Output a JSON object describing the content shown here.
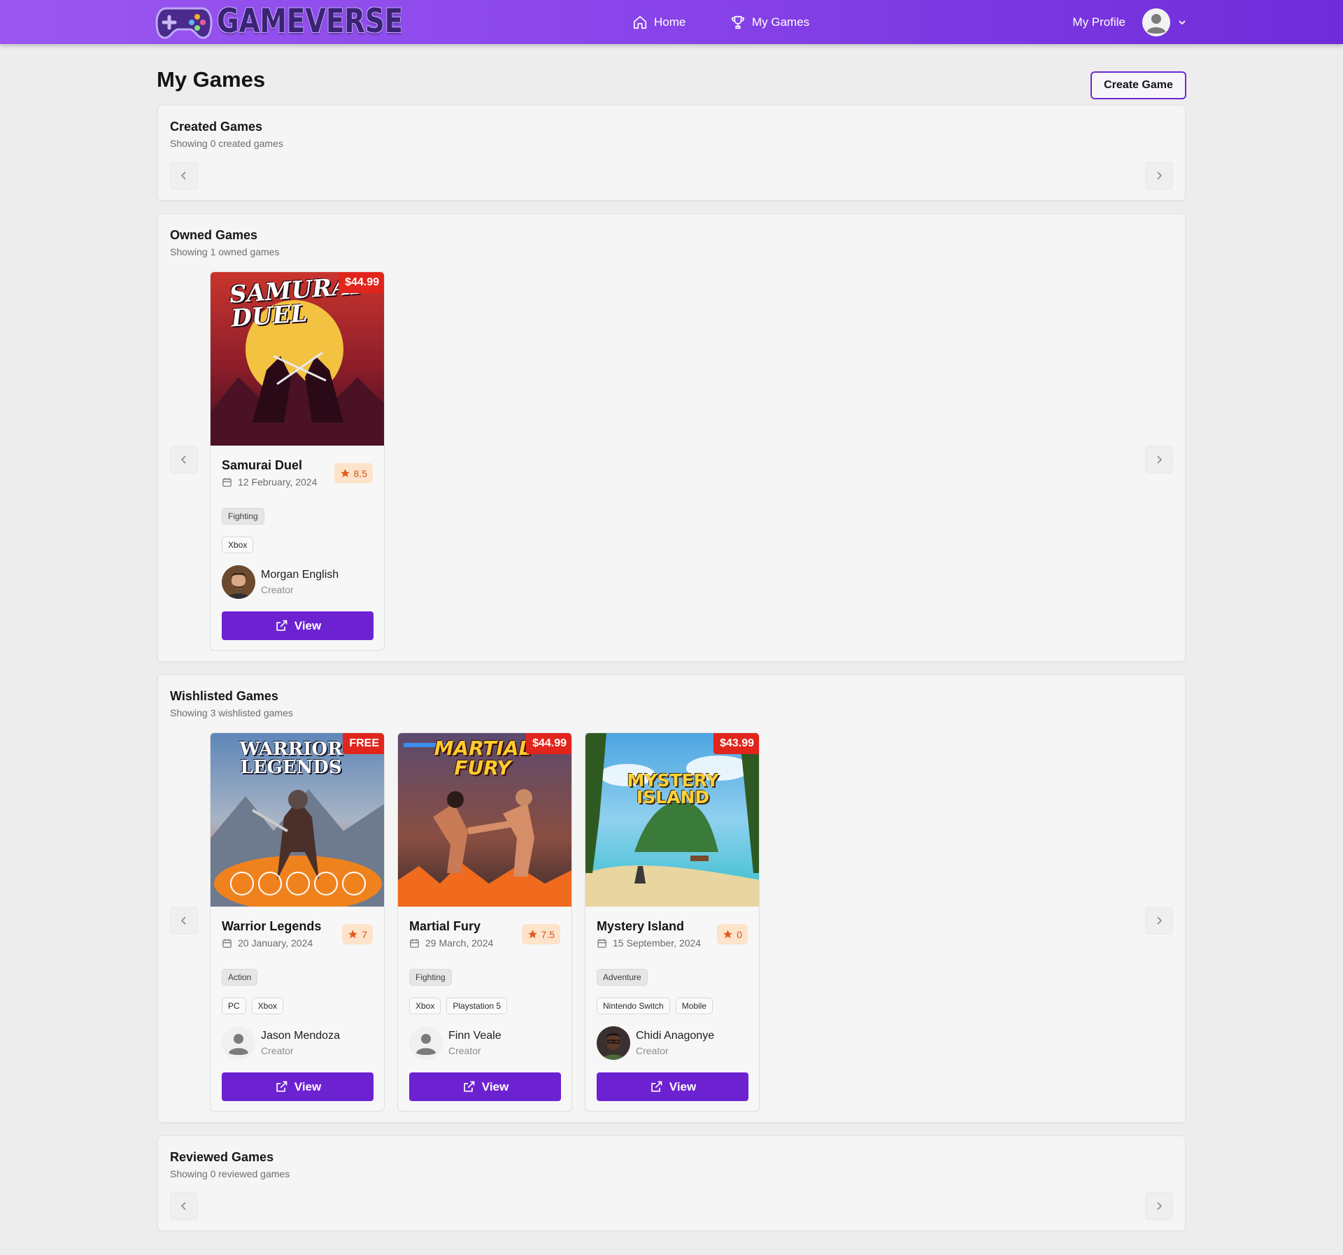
{
  "header": {
    "logo_text": "GAMEVERSE",
    "nav": [
      {
        "label": "Home",
        "icon": "home-icon"
      },
      {
        "label": "My Games",
        "icon": "trophy-icon"
      }
    ],
    "profile_label": "My Profile"
  },
  "page": {
    "title": "My Games",
    "create_button": "Create Game"
  },
  "sections": {
    "created": {
      "title": "Created Games",
      "subtitle": "Showing 0 created games"
    },
    "owned": {
      "title": "Owned Games",
      "subtitle": "Showing 1 owned games"
    },
    "wishlisted": {
      "title": "Wishlisted Games",
      "subtitle": "Showing 3 wishlisted games"
    },
    "reviewed": {
      "title": "Reviewed Games",
      "subtitle": "Showing 0 reviewed games"
    }
  },
  "owned_games": [
    {
      "title": "Samurai Duel",
      "cover_text": "SAMURAI DUEL",
      "price": "$44.99",
      "date": "12 February, 2024",
      "rating": "8.5",
      "genre": "Fighting",
      "platforms": [
        "Xbox"
      ],
      "creator": "Morgan English",
      "creator_role": "Creator",
      "view_label": "View"
    }
  ],
  "wishlisted_games": [
    {
      "title": "Warrior Legends",
      "cover_text": "WARRIOR LEGENDS",
      "price": "FREE",
      "date": "20 January, 2024",
      "rating": "7",
      "genre": "Action",
      "platforms": [
        "PC",
        "Xbox"
      ],
      "creator": "Jason Mendoza",
      "creator_role": "Creator",
      "view_label": "View"
    },
    {
      "title": "Martial Fury",
      "cover_text": "MARTIAL FURY",
      "price": "$44.99",
      "date": "29 March, 2024",
      "rating": "7.5",
      "genre": "Fighting",
      "platforms": [
        "Xbox",
        "Playstation 5"
      ],
      "creator": "Finn Veale",
      "creator_role": "Creator",
      "view_label": "View"
    },
    {
      "title": "Mystery Island",
      "cover_text": "MYSTERY ISLAND",
      "price": "$43.99",
      "date": "15 September, 2024",
      "rating": "0",
      "genre": "Adventure",
      "platforms": [
        "Nintendo Switch",
        "Mobile"
      ],
      "creator": "Chidi Anagonye",
      "creator_role": "Creator",
      "view_label": "View"
    }
  ],
  "colors": {
    "brand_purple": "#6d22d2",
    "header_gradient_start": "#9b57f0",
    "price_badge": "#e1251c",
    "rating_bg": "#fde3c9",
    "rating_fg": "#d0551b"
  }
}
